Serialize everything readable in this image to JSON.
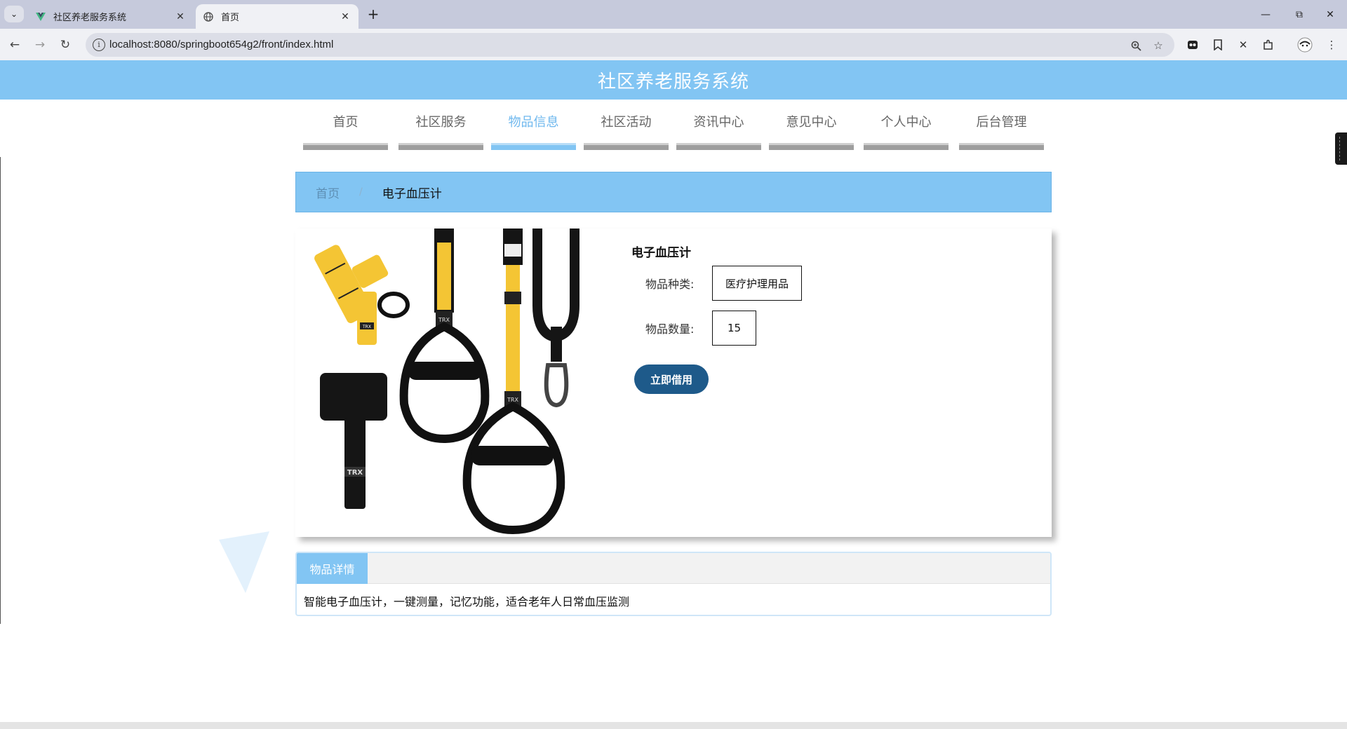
{
  "browser": {
    "tabs": [
      {
        "title": "社区养老服务系统",
        "icon": "vue-icon",
        "active": false
      },
      {
        "title": "首页",
        "icon": "globe-icon",
        "active": true
      }
    ],
    "url": "localhost:8080/springboot654g2/front/index.html"
  },
  "site": {
    "title": "社区养老服务系统"
  },
  "nav": {
    "items": [
      {
        "label": "首页",
        "active": false
      },
      {
        "label": "社区服务",
        "active": false
      },
      {
        "label": "物品信息",
        "active": true
      },
      {
        "label": "社区活动",
        "active": false
      },
      {
        "label": "资讯中心",
        "active": false
      },
      {
        "label": "意见中心",
        "active": false
      },
      {
        "label": "个人中心",
        "active": false
      },
      {
        "label": "后台管理",
        "active": false
      }
    ]
  },
  "breadcrumb": {
    "home": "首页",
    "separator": "/",
    "current": "电子血压计"
  },
  "product": {
    "name": "电子血压计",
    "category_label": "物品种类:",
    "category_value": "医疗护理用品",
    "quantity_label": "物品数量:",
    "quantity_value": "15",
    "borrow_button": "立即借用",
    "image_text": [
      "TRX",
      "TRX",
      "TRX",
      "TRX"
    ]
  },
  "detail_tabs": {
    "active_tab": "物品详情",
    "content": "智能电子血压计，一键测量，记忆功能，适合老年人日常血压监测"
  },
  "colors": {
    "primary": "#82c5f3",
    "button": "#1e5a8a",
    "nav_bar": "#9e9e9e"
  }
}
